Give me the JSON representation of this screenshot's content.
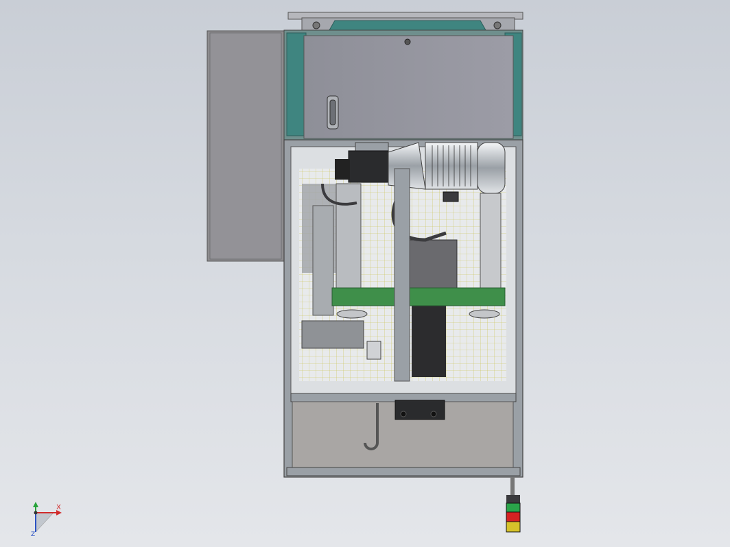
{
  "viewport": {
    "background_top": "#c9ced6",
    "background_bottom": "#e4e6ea"
  },
  "model": {
    "frame_color": "#8e939a",
    "panel_color": "#a9a9b2",
    "cabinet_color": "#8f8f98",
    "accent_green": "#3f8f4a",
    "door_trim": "#3f8580",
    "grid_line_color": "#c9c24a"
  },
  "stack_light": {
    "segments": [
      "green",
      "red",
      "yellow"
    ],
    "colors": [
      "#2aa44a",
      "#d52222",
      "#d6c22a"
    ]
  },
  "triad": {
    "x_label": "X",
    "z_label": "Z",
    "x_color": "#d12b2b",
    "y_color": "#27a33a",
    "z_color": "#2b52c4"
  }
}
